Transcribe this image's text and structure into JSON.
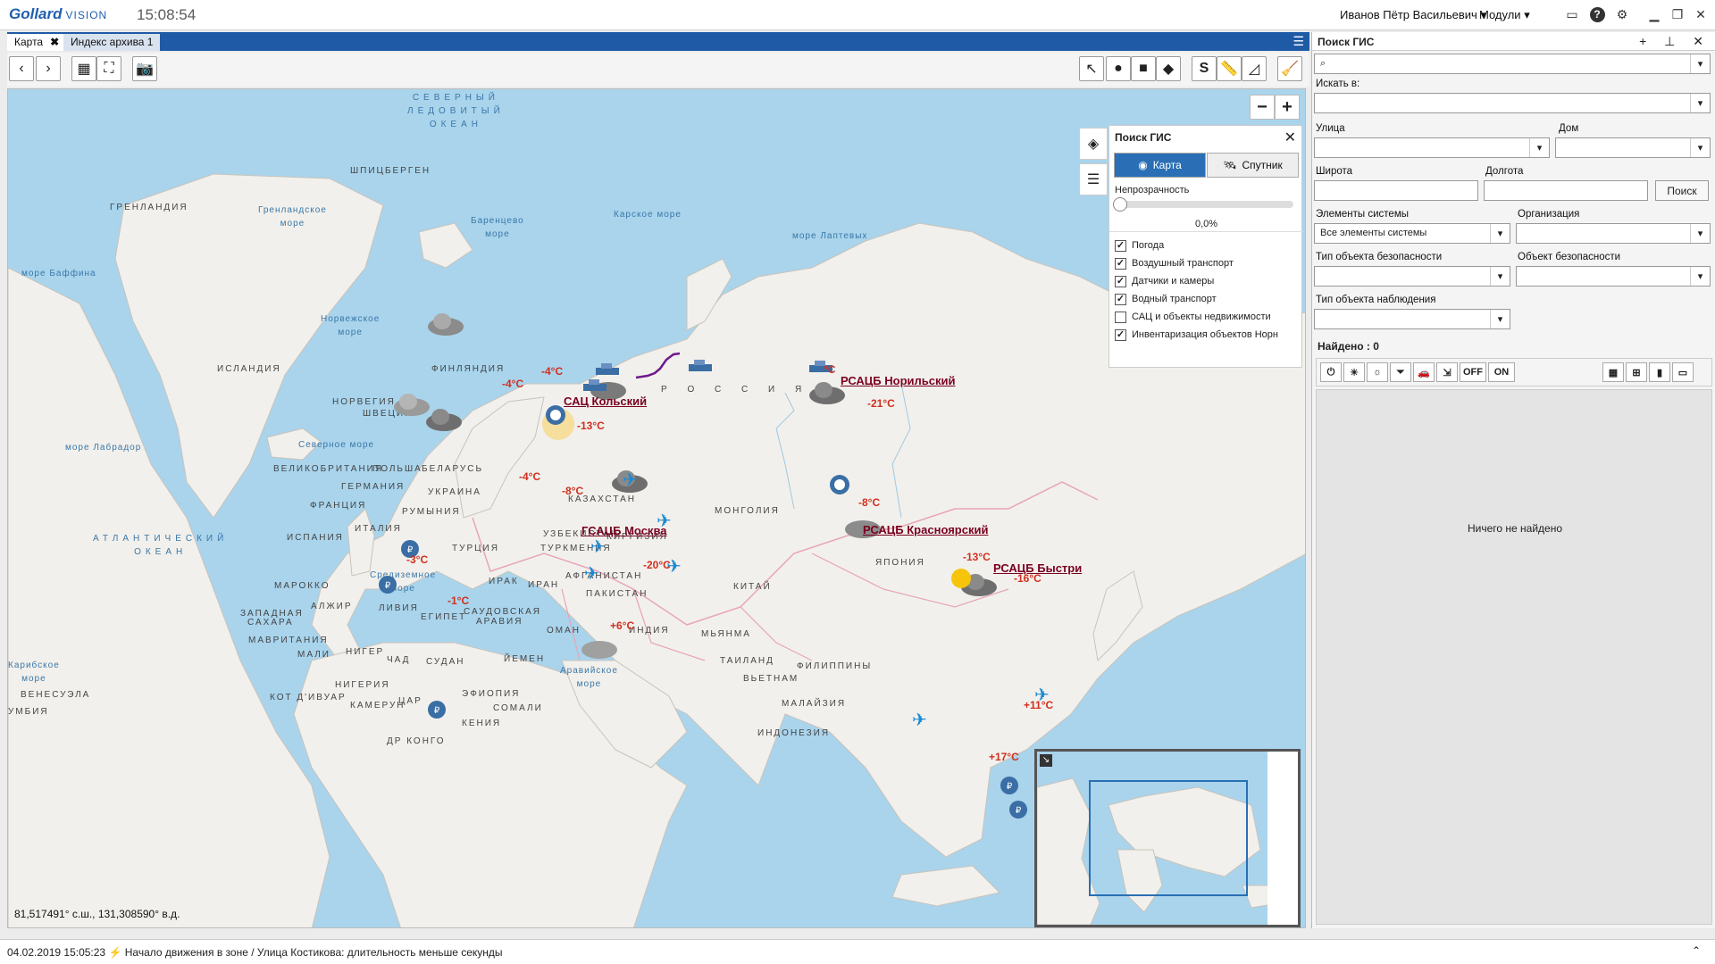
{
  "app": {
    "logo": "Gollard",
    "logo_sub": "VISION",
    "clock": "15:08:54",
    "user": "Иванов Пётр Васильевич",
    "modules": "Модули"
  },
  "tabs": [
    {
      "label": "Карта",
      "active": true
    },
    {
      "label": "Индекс архива 1",
      "active": false
    }
  ],
  "map": {
    "coords": "81,517491° с.ш., 131,308590° в.д.",
    "seas": [
      "СЕВЕРНЫЙ",
      "ЛЕДОВИТЫЙ",
      "ОКЕАН",
      "Гренландское",
      "море",
      "Баренцево",
      "море",
      "Карское море",
      "море Лаптевых",
      "море Баффина",
      "Норвежское",
      "море",
      "Северное море",
      "море Лабрадор",
      "АТЛАНТИЧЕСКИЙ",
      "ОКЕАН",
      "Средиземное",
      "море",
      "Аравийское",
      "море",
      "Карибское",
      "море"
    ],
    "countries": [
      "ГРЕНЛАНДИЯ",
      "ШПИЦБЕРГЕН",
      "ИСЛАНДИЯ",
      "ФИНЛЯНДИЯ",
      "НОРВЕГИЯ",
      "ШВЕЦИЯ",
      "ВЕЛИКОБРИТАНИЯ",
      "ПОЛЬША",
      "БЕЛАРУСЬ",
      "ГЕРМАНИЯ",
      "ФРАНЦИЯ",
      "УКРАИНА",
      "РУМЫНИЯ",
      "ИТАЛИЯ",
      "ИСПАНИЯ",
      "ТУРЦИЯ",
      "Р О С С И Я",
      "КАЗАХСТАН",
      "МОНГОЛИЯ",
      "УЗБЕКИСТАН",
      "КИРГИЗИЯ",
      "ТУРКМЕНИЯ",
      "АФГАНИСТАН",
      "ПАКИСТАН",
      "ИРАН",
      "ИРАК",
      "КИТАЙ",
      "ЯПОНИЯ",
      "МАРОККО",
      "АЛЖИР",
      "ЛИВИЯ",
      "ЕГИПЕТ",
      "САУДОВСКАЯ",
      "АРАВИЯ",
      "ЗАПАДНАЯ",
      "САХАРА",
      "МАВРИТАНИЯ",
      "МАЛИ",
      "НИГЕР",
      "ЧАД",
      "СУДАН",
      "НИГЕРИЯ",
      "ЙЕМЕН",
      "ОМАН",
      "ИНДИЯ",
      "МЬЯНМА",
      "ТАИЛАНД",
      "ВЬЕТНАМ",
      "ФИЛИППИНЫ",
      "МАЛАЙЗИЯ",
      "ИНДОНЕЗИЯ",
      "ЭФИОПИЯ",
      "СОМАЛИ",
      "КЕНИЯ",
      "ЦАР",
      "КАМЕРУН",
      "КОТ Д'ИВУАР",
      "ВЕНЕСУЭЛА",
      "УМБИЯ",
      "ДР КОНГО"
    ],
    "temps": [
      "-4°C",
      "-4°C",
      "-13°C",
      "-4°C",
      "-8°C",
      "-3°C",
      "-1°C",
      "-20°C",
      "+6°C",
      "-21°C",
      "-8°C",
      "-13°C",
      "-16°C",
      "+11°C",
      "+17°C",
      "°C"
    ],
    "stations": [
      "САЦ Кольский",
      "РСАЦБ Норильский",
      "ГСАЦБ Москва",
      "РСАЦБ Красноярский",
      "РСАЦБ Быстри"
    ]
  },
  "layers": {
    "title": "Поиск ГИС",
    "mode_map": "Карта",
    "mode_sat": "Спутник",
    "opacity_label": "Непрозрачность",
    "opacity": 0,
    "opacity_text": "0,0%",
    "items": [
      {
        "label": "Погода",
        "checked": true
      },
      {
        "label": "Воздушный транспорт",
        "checked": true
      },
      {
        "label": "Датчики и камеры",
        "checked": true
      },
      {
        "label": "Водный транспорт",
        "checked": true
      },
      {
        "label": "САЦ и объекты недвижимости",
        "checked": false
      },
      {
        "label": "Инвентаризация объектов Норн",
        "checked": true
      }
    ]
  },
  "gis": {
    "title": "Поиск ГИС",
    "search_in": "Искать в:",
    "street": "Улица",
    "house": "Дом",
    "lat": "Широта",
    "lon": "Долгота",
    "search_btn": "Поиск",
    "elements": "Элементы системы",
    "elements_value": "Все элементы системы",
    "org": "Организация",
    "sec_type": "Тип объекта безопасности",
    "sec_obj": "Объект безопасности",
    "obs_type": "Тип объекта наблюдения",
    "found": "Найдено : 0",
    "empty": "Ничего не найдено",
    "tools": [
      "OFF",
      "ON"
    ]
  },
  "status": {
    "time": "04.02.2019 15:05:23",
    "message": "Начало движения в зоне / Улица Костикова: длительность меньше секунды"
  }
}
